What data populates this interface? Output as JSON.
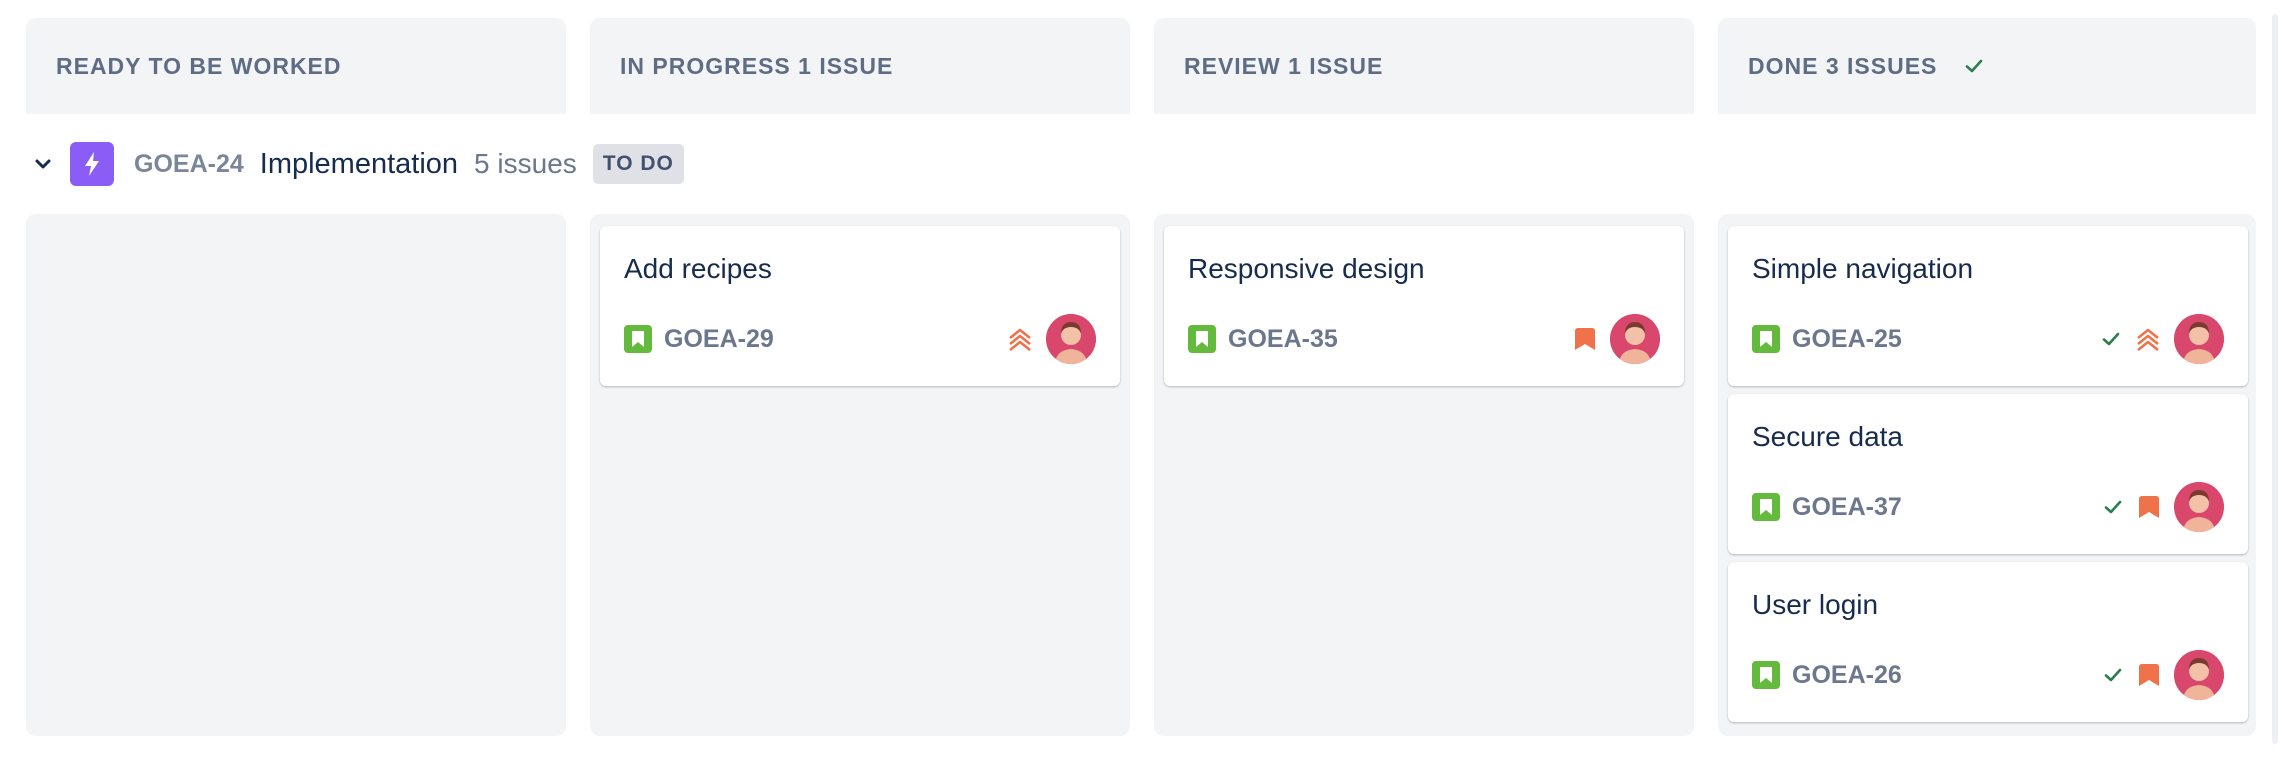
{
  "columns": [
    {
      "id": "ready",
      "title": "READY TO BE WORKED",
      "count_label": ""
    },
    {
      "id": "progress",
      "title": "IN PROGRESS 1 ISSUE",
      "count_label": ""
    },
    {
      "id": "review",
      "title": "REVIEW 1 ISSUE",
      "count_label": ""
    },
    {
      "id": "done",
      "title": "DONE 3 ISSUES",
      "count_label": ""
    }
  ],
  "swimlane": {
    "epic_key": "GOEA-24",
    "epic_title": "Implementation",
    "issue_count": "5 issues",
    "status": "TO DO",
    "epic_color": "#8b5cf6"
  },
  "cards": {
    "progress": [
      {
        "title": "Add recipes",
        "key": "GOEA-29",
        "priority": "highest",
        "done": false
      }
    ],
    "review": [
      {
        "title": "Responsive design",
        "key": "GOEA-35",
        "priority": "medium",
        "done": false
      }
    ],
    "done": [
      {
        "title": "Simple navigation",
        "key": "GOEA-25",
        "priority": "highest",
        "done": true
      },
      {
        "title": "Secure data",
        "key": "GOEA-37",
        "priority": "medium",
        "done": true
      },
      {
        "title": "User login",
        "key": "GOEA-26",
        "priority": "medium",
        "done": true
      }
    ]
  },
  "icons": {
    "story": "story-bookmark-icon",
    "priority_highest": "priority-highest-icon",
    "priority_medium": "priority-medium-icon",
    "done_check": "check-icon",
    "avatar": "user-avatar"
  },
  "colors": {
    "story_green": "#63ba3c",
    "priority_orange": "#f0724a",
    "check_green": "#2e7d4f",
    "column_bg": "#f3f4f6"
  }
}
